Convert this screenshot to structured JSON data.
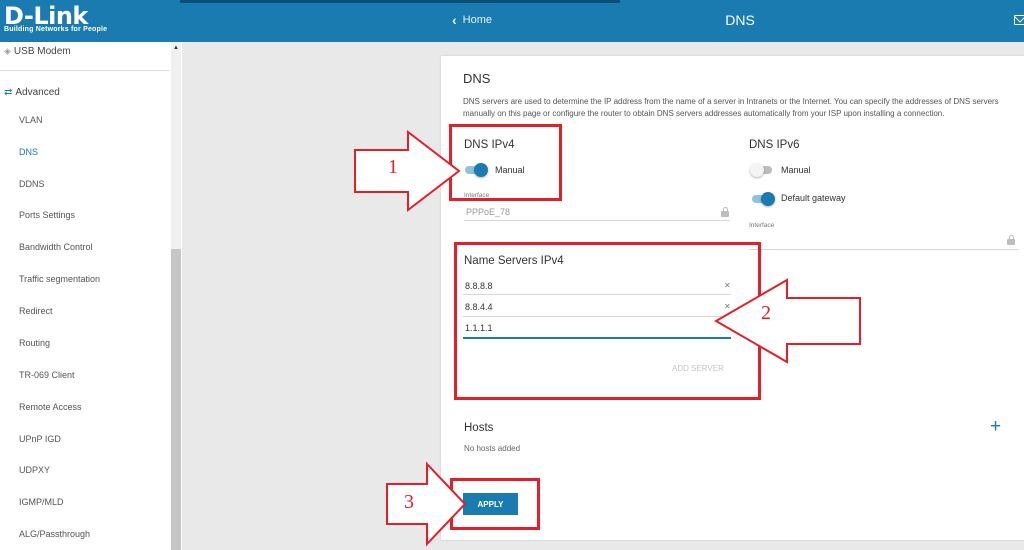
{
  "header": {
    "brand": "D-Link",
    "tagline": "Building Networks for People",
    "home_label": "Home",
    "title": "DNS"
  },
  "sidebar": {
    "top_item": "USB Modem",
    "section": "Advanced",
    "items": [
      {
        "label": "VLAN",
        "active": false
      },
      {
        "label": "DNS",
        "active": true
      },
      {
        "label": "DDNS",
        "active": false
      },
      {
        "label": "Ports Settings",
        "active": false
      },
      {
        "label": "Bandwidth Control",
        "active": false
      },
      {
        "label": "Traffic segmentation",
        "active": false
      },
      {
        "label": "Redirect",
        "active": false
      },
      {
        "label": "Routing",
        "active": false
      },
      {
        "label": "TR-069 Client",
        "active": false
      },
      {
        "label": "Remote Access",
        "active": false
      },
      {
        "label": "UPnP IGD",
        "active": false
      },
      {
        "label": "UDPXY",
        "active": false
      },
      {
        "label": "IGMP/MLD",
        "active": false
      },
      {
        "label": "ALG/Passthrough",
        "active": false
      }
    ]
  },
  "main": {
    "heading": "DNS",
    "description": "DNS servers are used to determine the IP address from the name of a server in Intranets or the Internet. You can specify the addresses of DNS servers manually on this page or configure the router to obtain DNS servers addresses automatically from your ISP upon installing a connection.",
    "ipv4": {
      "title": "DNS IPv4",
      "manual_label": "Manual",
      "manual_on": true,
      "interface_label": "Interface",
      "interface_value": "PPPoE_78"
    },
    "ipv6": {
      "title": "DNS IPv6",
      "manual_label": "Manual",
      "manual_on": false,
      "default_gw_label": "Default gateway",
      "default_gw_on": true,
      "interface_label": "Interface",
      "interface_value": ""
    },
    "name_servers": {
      "title": "Name Servers IPv4",
      "servers": [
        "8.8.8.8",
        "8.8.4.4",
        "1.1.1.1"
      ],
      "add_label": "ADD SERVER"
    },
    "hosts": {
      "title": "Hosts",
      "empty_text": "No hosts added"
    },
    "apply_label": "APPLY"
  },
  "annotations": {
    "labels": [
      "1",
      "2",
      "3"
    ],
    "color": "#e3202a"
  },
  "colors": {
    "accent": "#1a7bb0",
    "annotation": "#e3202a"
  }
}
